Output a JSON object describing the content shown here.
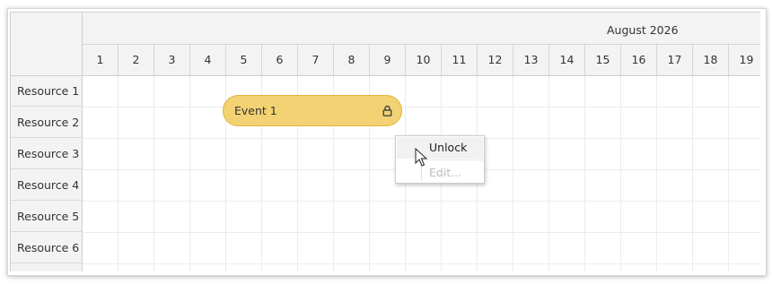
{
  "month": "August 2026",
  "days": [
    "1",
    "2",
    "3",
    "4",
    "5",
    "6",
    "7",
    "8",
    "9",
    "10",
    "11",
    "12",
    "13",
    "14",
    "15",
    "16",
    "17",
    "18",
    "19"
  ],
  "resources": [
    "Resource 1",
    "Resource 2",
    "Resource 3",
    "Resource 4",
    "Resource 5",
    "Resource 6"
  ],
  "event": {
    "title": "Event 1",
    "resource": "Resource 2",
    "start_day": "5",
    "end_day": "9",
    "color": "#f2d272",
    "border_color": "#e1b640",
    "icon": "lock-icon"
  },
  "context_menu": {
    "unlock": "Unlock",
    "edit": "Edit...",
    "edit_disabled": true
  },
  "colors": {
    "header_bg": "#f3f3f3",
    "grid_line": "#ececec",
    "menu_hover": "#f1f1f1"
  }
}
